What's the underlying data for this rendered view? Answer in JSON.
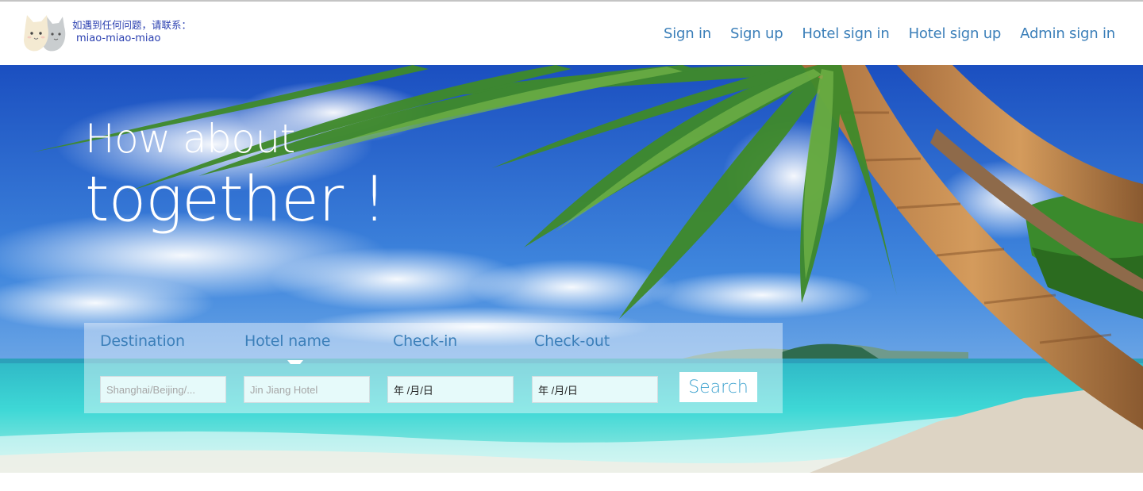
{
  "header": {
    "contact_line": "如遇到任何问题，请联系：",
    "contact_handle": "miao-miao-miao"
  },
  "nav": {
    "items": [
      "Sign in",
      "Sign up",
      "Hotel sign in",
      "Hotel sign up",
      "Admin sign in"
    ]
  },
  "hero": {
    "headline_line1": "How about",
    "headline_line2": "together !"
  },
  "search": {
    "destination_label": "Destination",
    "destination_placeholder": "Shanghai/Beijing/...",
    "hotel_label": "Hotel name",
    "hotel_placeholder": "Jin Jiang Hotel",
    "checkin_label": "Check-in",
    "checkin_value": "年 /月/日",
    "checkout_label": "Check-out",
    "checkout_value": "年 /月/日",
    "search_button": "Search"
  },
  "colors": {
    "nav_link": "#3b7fb9",
    "contact_text": "#2a3fb0",
    "search_button_text": "#3fa3cf"
  },
  "icons": {
    "logo": "two-cats-logo"
  }
}
